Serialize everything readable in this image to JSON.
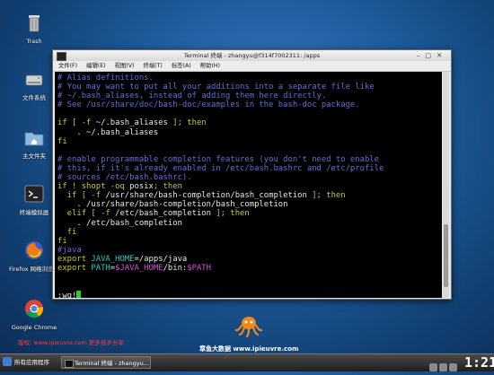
{
  "desktop": {
    "icons": [
      {
        "label": "Trash"
      },
      {
        "label": "文件系统"
      },
      {
        "label": "主文件夹"
      },
      {
        "label": "终端模拟器"
      },
      {
        "label": "Firefox 网络浏览器"
      },
      {
        "label": "Google Chrome"
      }
    ]
  },
  "window": {
    "title": "Terminal 终端 - zhangyu@f314f7002311: /apps",
    "menu": [
      "文件(F)",
      "编辑(E)",
      "视图(V)",
      "终端(T)",
      "标签(A)",
      "帮助(H)"
    ]
  },
  "terminal": {
    "lines": [
      [
        {
          "t": "# Alias definitions.",
          "c": "cm"
        }
      ],
      [
        {
          "t": "# You may want to put all your additions into a separate file like",
          "c": "cm"
        }
      ],
      [
        {
          "t": "# ~/.bash_aliases, instead of adding them here directly.",
          "c": "cm"
        }
      ],
      [
        {
          "t": "# See /usr/share/doc/bash-doc/examples in the bash-doc package.",
          "c": "cm"
        }
      ],
      [
        {
          "t": "",
          "c": "tx"
        }
      ],
      [
        {
          "t": "if [ -f ",
          "c": "kw"
        },
        {
          "t": "~/.bash_aliases",
          "c": "tx"
        },
        {
          "t": " ]; then",
          "c": "kw"
        }
      ],
      [
        {
          "t": "    . ~/.bash_aliases",
          "c": "tx"
        }
      ],
      [
        {
          "t": "fi",
          "c": "kw"
        }
      ],
      [
        {
          "t": "",
          "c": "tx"
        }
      ],
      [
        {
          "t": "# enable programmable completion features (you don't need to enable",
          "c": "cm"
        }
      ],
      [
        {
          "t": "# this, if it's already enabled in /etc/bash.bashrc and /etc/profile",
          "c": "cm"
        }
      ],
      [
        {
          "t": "# sources /etc/bash.bashrc).",
          "c": "cm"
        }
      ],
      [
        {
          "t": "if ! shopt -oq ",
          "c": "kw"
        },
        {
          "t": "posix",
          "c": "tx"
        },
        {
          "t": "; then",
          "c": "kw"
        }
      ],
      [
        {
          "t": "  if [ -f ",
          "c": "kw"
        },
        {
          "t": "/usr/share/bash-completion/bash_completion",
          "c": "tx"
        },
        {
          "t": " ]; then",
          "c": "kw"
        }
      ],
      [
        {
          "t": "    . /usr/share/bash-completion/bash_completion",
          "c": "tx"
        }
      ],
      [
        {
          "t": "  elif [ -f ",
          "c": "kw"
        },
        {
          "t": "/etc/bash_completion",
          "c": "tx"
        },
        {
          "t": " ]; then",
          "c": "kw"
        }
      ],
      [
        {
          "t": "    . /etc/bash_completion",
          "c": "tx"
        }
      ],
      [
        {
          "t": "  fi",
          "c": "kw"
        }
      ],
      [
        {
          "t": "fi",
          "c": "kw"
        }
      ],
      [
        {
          "t": "#java",
          "c": "cm"
        }
      ],
      [
        {
          "t": "export ",
          "c": "kw"
        },
        {
          "t": "JAVA_HOME",
          "c": "cy"
        },
        {
          "t": "=/apps/java",
          "c": "tx"
        }
      ],
      [
        {
          "t": "export ",
          "c": "kw"
        },
        {
          "t": "PATH",
          "c": "cy"
        },
        {
          "t": "=",
          "c": "tx"
        },
        {
          "t": "$JAVA_HOME",
          "c": "mg"
        },
        {
          "t": "/bin:",
          "c": "tx"
        },
        {
          "t": "$PATH",
          "c": "mg"
        }
      ],
      [
        {
          "t": "",
          "c": "tx"
        }
      ],
      [
        {
          "t": "",
          "c": "tx"
        }
      ],
      [
        {
          "t": ":wq!",
          "c": "tx"
        }
      ]
    ]
  },
  "watermarks": {
    "left": "版权: www.ipieuvre.com 更多技术分享",
    "right": "章鱼大数据 www.ipieuvre.com"
  },
  "taskbar": {
    "start_label": "所有应用程序",
    "task_label": "Terminal 终端 - zhangyu...",
    "clock": "1:21"
  }
}
